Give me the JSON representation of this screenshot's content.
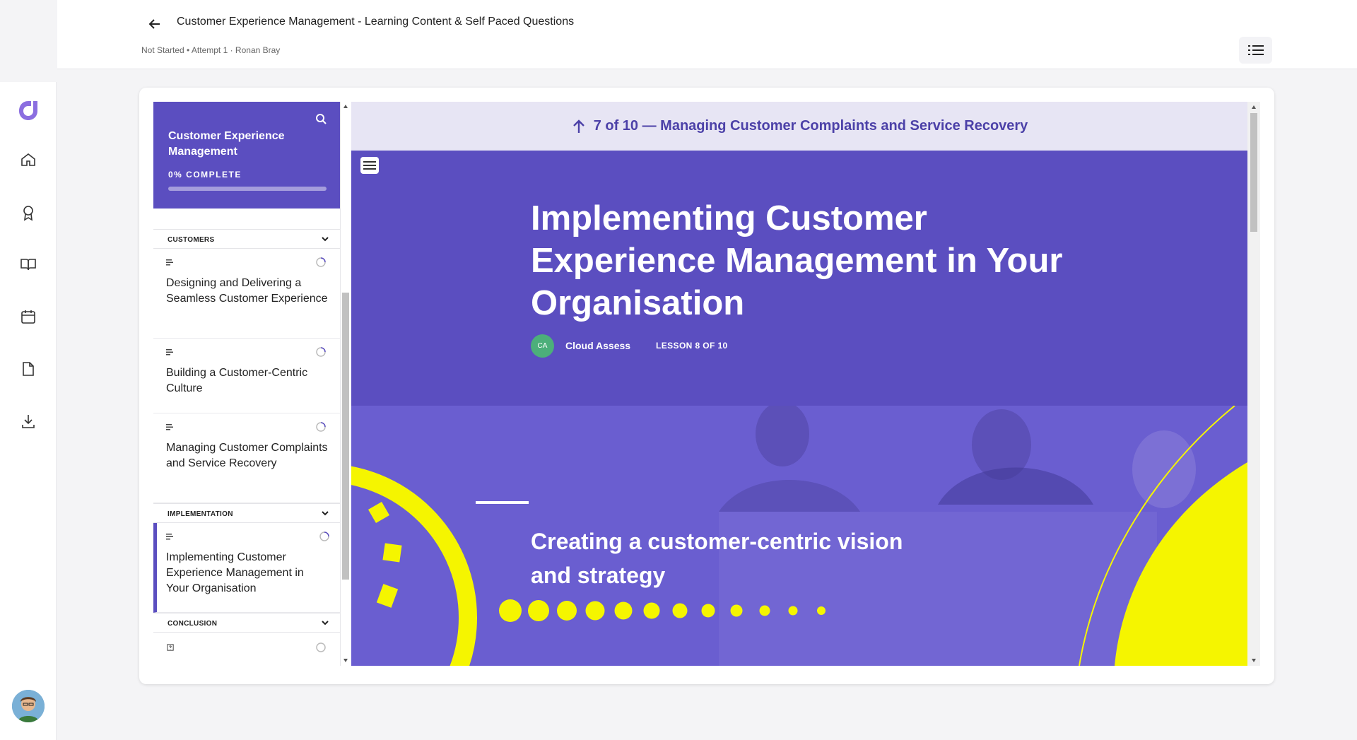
{
  "header": {
    "title": "Customer Experience Management - Learning Content & Self Paced Questions",
    "subtitle": "Not Started • Attempt 1 · Ronan Bray"
  },
  "rail": {
    "items": [
      "home-icon",
      "award-icon",
      "book-icon",
      "calendar-icon",
      "document-icon",
      "download-icon"
    ]
  },
  "sidebar": {
    "course_title": "Customer Experience Management",
    "progress_label": "0% COMPLETE",
    "progress": 0,
    "sections": [
      {
        "label": "CUSTOMERS"
      },
      {
        "label": "IMPLEMENTATION"
      },
      {
        "label": "CONCLUSION"
      }
    ],
    "items": [
      {
        "label": "Designing and Delivering a Seamless Customer Experience"
      },
      {
        "label": "Building a Customer-Centric Culture"
      },
      {
        "label": "Managing Customer Complaints and Service Recovery"
      },
      {
        "label": "Implementing Customer Experience Management in Your Organisation"
      }
    ]
  },
  "lesson": {
    "prev_link": "7 of 10 — Managing Customer Complaints and Service Recovery",
    "title": "Implementing Customer Experience Management in Your Organisation",
    "author_initials": "CA",
    "author": "Cloud Assess",
    "lesson_counter": "LESSON 8 OF 10",
    "banner_text": "Creating a customer-centric vision and strategy"
  },
  "colors": {
    "primary": "#5b4ec0",
    "accent_yellow": "#f5f500",
    "prev_bar": "#e7e5f4"
  }
}
